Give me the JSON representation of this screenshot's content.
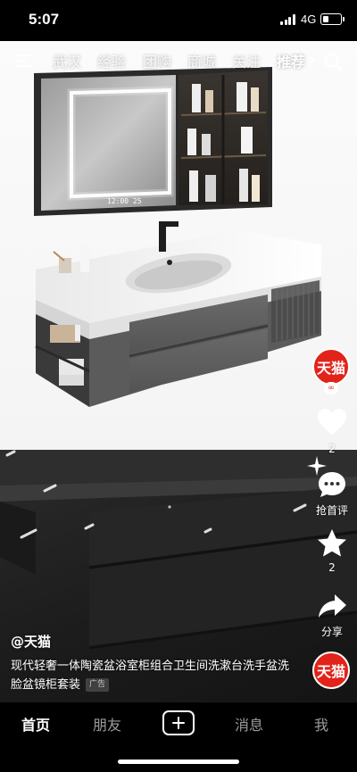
{
  "status_bar": {
    "time": "5:07",
    "network": "4G",
    "battery_level": 0.35
  },
  "top_nav": {
    "tabs": [
      {
        "label": "武汉",
        "active": false
      },
      {
        "label": "经验",
        "active": false
      },
      {
        "label": "团购",
        "active": false
      },
      {
        "label": "商城",
        "active": false
      },
      {
        "label": "关注",
        "active": false
      },
      {
        "label": "推荐",
        "active": true
      }
    ]
  },
  "actions": {
    "tmall_label": "天猫",
    "like_count": "2",
    "comment_label": "抢首评",
    "favorite_count": "2",
    "share_label": "分享"
  },
  "caption": {
    "author": "@天猫",
    "text": "现代轻奢一体陶瓷盆浴室柜组合卫生间洗漱台洗手盆洗脸盆镜柜套装",
    "ad_badge": "广告"
  },
  "tab_bar": {
    "items": [
      {
        "label": "首页",
        "active": true
      },
      {
        "label": "朋友",
        "active": false
      },
      {
        "label": "消息",
        "active": false
      },
      {
        "label": "我",
        "active": false
      }
    ]
  },
  "product_image": {
    "mirror_display": "12:00 25"
  },
  "colors": {
    "accent_red": "#e2231a",
    "background": "#000000"
  }
}
